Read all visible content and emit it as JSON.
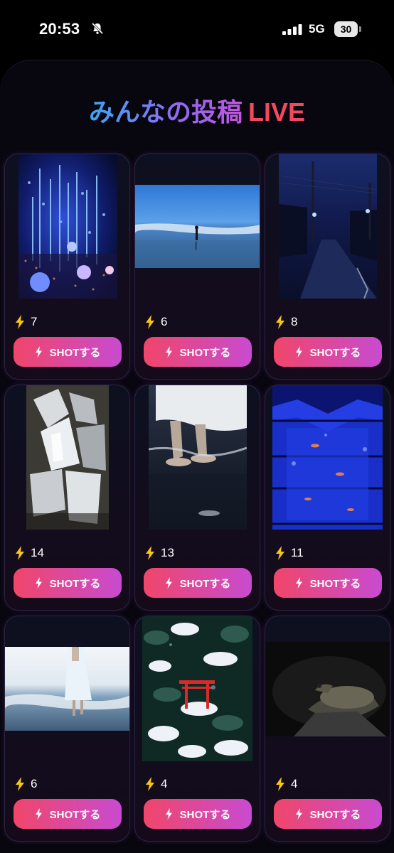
{
  "status": {
    "time": "20:53",
    "network": "5G",
    "battery": "30"
  },
  "header": {
    "title": "みんなの投稿",
    "live": "LIVE"
  },
  "posts": [
    {
      "count": "7",
      "button": "SHOTする"
    },
    {
      "count": "6",
      "button": "SHOTする"
    },
    {
      "count": "8",
      "button": "SHOTする"
    },
    {
      "count": "14",
      "button": "SHOTする"
    },
    {
      "count": "13",
      "button": "SHOTする"
    },
    {
      "count": "11",
      "button": "SHOTする"
    },
    {
      "count": "6",
      "button": "SHOTする"
    },
    {
      "count": "4",
      "button": "SHOTする"
    },
    {
      "count": "4",
      "button": "SHOTする"
    }
  ],
  "colors": {
    "accent_start": "#f0466a",
    "accent_end": "#c84bd0",
    "live": "#f2495e",
    "bolt": "#f5c518"
  }
}
